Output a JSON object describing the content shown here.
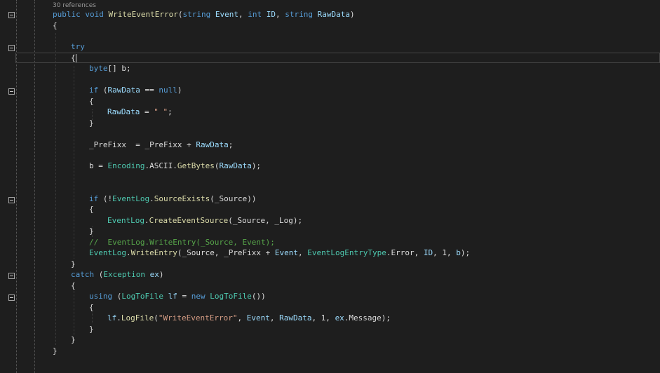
{
  "editor": {
    "codelens": "30 references",
    "lines": [
      {
        "tokens": [
          {
            "t": "public",
            "c": "kw"
          },
          {
            "t": " ",
            "c": "pl"
          },
          {
            "t": "void",
            "c": "kw"
          },
          {
            "t": " ",
            "c": "pl"
          },
          {
            "t": "WriteEventError",
            "c": "fn"
          },
          {
            "t": "(",
            "c": "pl"
          },
          {
            "t": "string",
            "c": "kw"
          },
          {
            "t": " ",
            "c": "pl"
          },
          {
            "t": "Event",
            "c": "prm"
          },
          {
            "t": ", ",
            "c": "pl"
          },
          {
            "t": "int",
            "c": "kw"
          },
          {
            "t": " ",
            "c": "pl"
          },
          {
            "t": "ID",
            "c": "prm"
          },
          {
            "t": ", ",
            "c": "pl"
          },
          {
            "t": "string",
            "c": "kw"
          },
          {
            "t": " ",
            "c": "pl"
          },
          {
            "t": "RawData",
            "c": "prm"
          },
          {
            "t": ")",
            "c": "pl"
          }
        ]
      },
      {
        "tokens": [
          {
            "t": "{",
            "c": "pl"
          }
        ]
      },
      {
        "tokens": [
          {
            "t": "try",
            "c": "kw"
          }
        ]
      },
      {
        "tokens": [
          {
            "t": "{",
            "c": "pl"
          }
        ]
      },
      {
        "tokens": [
          {
            "t": "byte",
            "c": "kw"
          },
          {
            "t": "[] b;",
            "c": "pl"
          }
        ]
      },
      {
        "tokens": [
          {
            "t": "if",
            "c": "kw"
          },
          {
            "t": " (",
            "c": "pl"
          },
          {
            "t": "RawData",
            "c": "prm"
          },
          {
            "t": " == ",
            "c": "pl"
          },
          {
            "t": "null",
            "c": "kw"
          },
          {
            "t": ")",
            "c": "pl"
          }
        ]
      },
      {
        "tokens": [
          {
            "t": "{",
            "c": "pl"
          }
        ]
      },
      {
        "tokens": [
          {
            "t": "RawData",
            "c": "prm"
          },
          {
            "t": " = ",
            "c": "pl"
          },
          {
            "t": "\" \"",
            "c": "str"
          },
          {
            "t": ";",
            "c": "pl"
          }
        ]
      },
      {
        "tokens": [
          {
            "t": "}",
            "c": "pl"
          }
        ]
      },
      {
        "tokens": [
          {
            "t": "_PreFixx  = _PreFixx + ",
            "c": "pl"
          },
          {
            "t": "RawData",
            "c": "prm"
          },
          {
            "t": ";",
            "c": "pl"
          }
        ]
      },
      {
        "tokens": [
          {
            "t": "b = ",
            "c": "pl"
          },
          {
            "t": "Encoding",
            "c": "ty"
          },
          {
            "t": ".ASCII.",
            "c": "pl"
          },
          {
            "t": "GetBytes",
            "c": "fn"
          },
          {
            "t": "(",
            "c": "pl"
          },
          {
            "t": "RawData",
            "c": "prm"
          },
          {
            "t": ");",
            "c": "pl"
          }
        ]
      },
      {
        "tokens": [
          {
            "t": "if",
            "c": "kw"
          },
          {
            "t": " (!",
            "c": "pl"
          },
          {
            "t": "EventLog",
            "c": "ty"
          },
          {
            "t": ".",
            "c": "pl"
          },
          {
            "t": "SourceExists",
            "c": "fn"
          },
          {
            "t": "(_Source))",
            "c": "pl"
          }
        ]
      },
      {
        "tokens": [
          {
            "t": "{",
            "c": "pl"
          }
        ]
      },
      {
        "tokens": [
          {
            "t": "EventLog",
            "c": "ty"
          },
          {
            "t": ".",
            "c": "pl"
          },
          {
            "t": "CreateEventSource",
            "c": "fn"
          },
          {
            "t": "(_Source, _Log);",
            "c": "pl"
          }
        ]
      },
      {
        "tokens": [
          {
            "t": "}",
            "c": "pl"
          }
        ]
      },
      {
        "tokens": [
          {
            "t": "//  EventLog.WriteEntry(_Source, Event);",
            "c": "cmt"
          }
        ]
      },
      {
        "tokens": [
          {
            "t": "EventLog",
            "c": "ty"
          },
          {
            "t": ".",
            "c": "pl"
          },
          {
            "t": "WriteEntry",
            "c": "fn"
          },
          {
            "t": "(_Source, _PreFixx + ",
            "c": "pl"
          },
          {
            "t": "Event",
            "c": "prm"
          },
          {
            "t": ", ",
            "c": "pl"
          },
          {
            "t": "EventLogEntryType",
            "c": "ty"
          },
          {
            "t": ".Error, ",
            "c": "pl"
          },
          {
            "t": "ID",
            "c": "prm"
          },
          {
            "t": ", 1, ",
            "c": "pl"
          },
          {
            "t": "b",
            "c": "prm"
          },
          {
            "t": ");",
            "c": "pl"
          }
        ]
      },
      {
        "tokens": [
          {
            "t": "}",
            "c": "pl"
          }
        ]
      },
      {
        "tokens": [
          {
            "t": "catch",
            "c": "kw"
          },
          {
            "t": " (",
            "c": "pl"
          },
          {
            "t": "Exception",
            "c": "ty"
          },
          {
            "t": " ",
            "c": "pl"
          },
          {
            "t": "ex",
            "c": "prm"
          },
          {
            "t": ")",
            "c": "pl"
          }
        ]
      },
      {
        "tokens": [
          {
            "t": "{",
            "c": "pl"
          }
        ]
      },
      {
        "tokens": [
          {
            "t": "using",
            "c": "kw"
          },
          {
            "t": " (",
            "c": "pl"
          },
          {
            "t": "LogToFile",
            "c": "ty"
          },
          {
            "t": " ",
            "c": "pl"
          },
          {
            "t": "lf",
            "c": "prm"
          },
          {
            "t": " = ",
            "c": "pl"
          },
          {
            "t": "new",
            "c": "kw"
          },
          {
            "t": " ",
            "c": "pl"
          },
          {
            "t": "LogToFile",
            "c": "ty"
          },
          {
            "t": "())",
            "c": "pl"
          }
        ]
      },
      {
        "tokens": [
          {
            "t": "{",
            "c": "pl"
          }
        ]
      },
      {
        "tokens": [
          {
            "t": "lf",
            "c": "prm"
          },
          {
            "t": ".",
            "c": "pl"
          },
          {
            "t": "LogFile",
            "c": "fn"
          },
          {
            "t": "(",
            "c": "pl"
          },
          {
            "t": "\"WriteEventError\"",
            "c": "str"
          },
          {
            "t": ", ",
            "c": "pl"
          },
          {
            "t": "Event",
            "c": "prm"
          },
          {
            "t": ", ",
            "c": "pl"
          },
          {
            "t": "RawData",
            "c": "prm"
          },
          {
            "t": ", 1, ",
            "c": "pl"
          },
          {
            "t": "ex",
            "c": "prm"
          },
          {
            "t": ".Message);",
            "c": "pl"
          }
        ]
      },
      {
        "tokens": [
          {
            "t": "}",
            "c": "pl"
          }
        ]
      },
      {
        "tokens": [
          {
            "t": "}",
            "c": "pl"
          }
        ]
      },
      {
        "tokens": [
          {
            "t": "}",
            "c": "pl"
          }
        ]
      }
    ]
  }
}
